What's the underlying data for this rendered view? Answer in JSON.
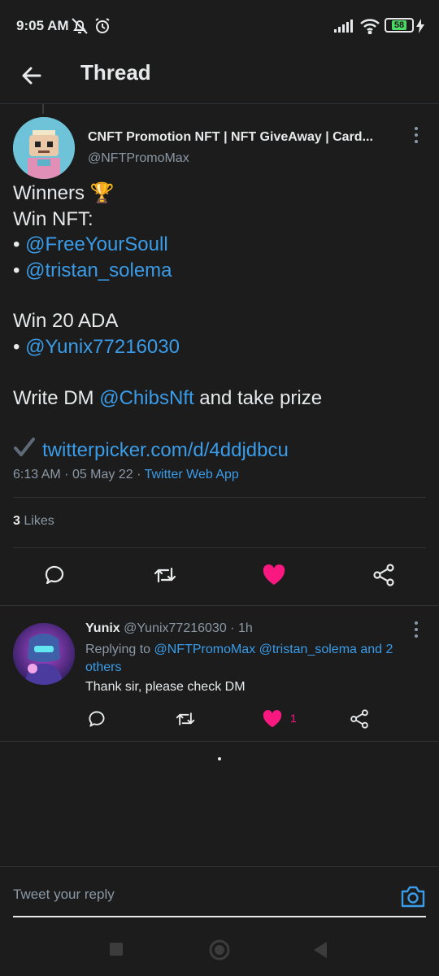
{
  "status_bar": {
    "time": "9:05 AM",
    "battery": "58",
    "icons": [
      "mute-icon",
      "alarm-icon",
      "signal-icon",
      "wifi-icon",
      "battery-icon",
      "charging-icon"
    ]
  },
  "header": {
    "title": "Thread",
    "back_icon": "arrow-left-icon"
  },
  "tweet": {
    "author_name": "CNFT Promotion NFT | NFT GiveAway | Card...",
    "author_handle": "@NFTPromoMax",
    "line1": "Winners",
    "trophy": "🏆",
    "line2": "Win NFT:",
    "bullet": "•",
    "mention1": "@FreeYourSoull",
    "mention2": "@tristan_solema",
    "line3": "Win 20 ADA",
    "mention3": "@Yunix77216030",
    "line4_prefix": "Write DM",
    "mention4": "@ChibsNft",
    "line4_suffix": "and take prize",
    "check": "✔",
    "link": "twitterpicker.com/d/4ddjdbcu",
    "time": "6:13 AM",
    "sep": "·",
    "date": "05 May 22",
    "source": "Twitter Web App",
    "likes_count": "3",
    "likes_label": "Likes"
  },
  "reply": {
    "name": "Yunix",
    "handle": "@Yunix77216030",
    "age": "· 1h",
    "replying_prefix": "Replying to",
    "replying_mentions": "@NFTPromoMax @tristan_solema and 2 others",
    "text": "Thank sir, please check DM",
    "like_count": "1"
  },
  "reply_bar": {
    "placeholder": "Tweet your reply"
  },
  "colors": {
    "background": "#1c1c1c",
    "link": "#3a9ce8",
    "like": "#f91880",
    "muted": "#8b98a5"
  }
}
